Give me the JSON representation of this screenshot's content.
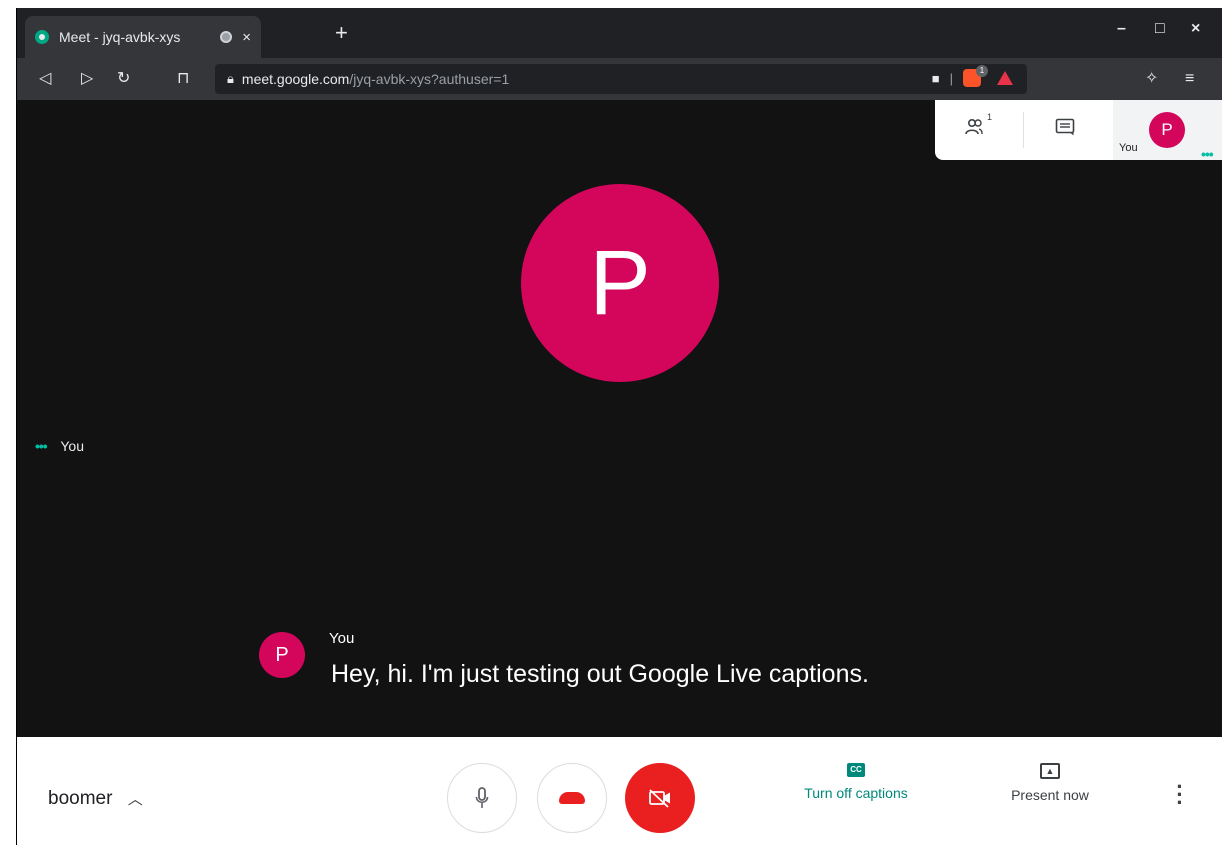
{
  "browser": {
    "tab_title": "Meet - jyq-avbk-xys",
    "tab_close": "×",
    "new_tab": "+",
    "url_host": "meet.google.com",
    "url_path": "/jyq-avbk-xys?authuser=1",
    "brave_badge": "1",
    "window_controls": {
      "minimize": "–",
      "maximize": "□",
      "close": "×"
    }
  },
  "meet_panel": {
    "people_count": "1",
    "self_label": "You",
    "self_initial": "P"
  },
  "main": {
    "participant_initial": "P",
    "self_tile_label": "You"
  },
  "caption": {
    "initial": "P",
    "speaker": "You",
    "text": "Hey, hi. I'm just testing out Google Live captions."
  },
  "controls": {
    "meeting_name": "boomer",
    "captions_label": "Turn off captions",
    "captions_icon_text": "CC",
    "present_label": "Present now"
  },
  "colors": {
    "avatar": "#d3065c",
    "red": "#ea1f1f",
    "caption_accent": "#00897b",
    "activity_dots": "#00bfa5",
    "stage_bg": "#121212"
  }
}
